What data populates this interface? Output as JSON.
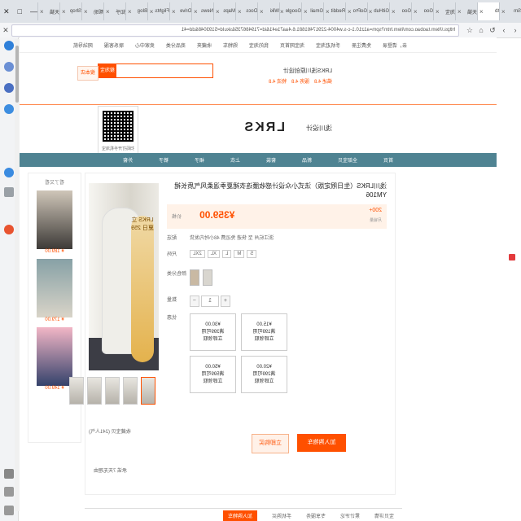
{
  "tabs": [
    "Sm",
    "tb",
    "天猫",
    "淘宝",
    "Goo",
    "Goo",
    "GitHub",
    "GoPro",
    "Reddit",
    "Gmail",
    "Google",
    "Wiki",
    "Docs",
    "Maps",
    "News",
    "Drive",
    "Flights",
    "Blog",
    "知乎",
    "帮助",
    "Shop",
    "天猫"
  ],
  "tab_colors": [
    "#ff5000",
    "#ff5000",
    "#e4393c",
    "#ff5000",
    "#4285f4",
    "#34a853",
    "#24292e",
    "#2a9fd8",
    "#ff4500",
    "#ea4335",
    "#4285f4",
    "#777777",
    "#4285f4",
    "#34a853",
    "#5f6368",
    "#0f9d58",
    "#4285f4",
    "#f57c00",
    "#0084ff",
    "#1976d2",
    "#ff5000",
    "#e4393c"
  ],
  "window_controls": {
    "min": "—",
    "max": "□",
    "close": "✕"
  },
  "address": {
    "url": "https://item.taobao.com/item.htm?spm=a1z10.1-c-s.w4004-22917461681.6.4aa71e41&id=719486735&skuId=5193048&dd=41"
  },
  "site_nav": [
    "亲，请登录",
    "免费注册",
    "手机逛淘宝",
    "淘宝网首页",
    "我的淘宝",
    "购物车",
    "收藏夹",
    "商品分类",
    "卖家中心",
    "联系客服",
    "网站导航"
  ],
  "shop": {
    "name": "LRKS浅川原创设计",
    "ratings": [
      "描述 4.8",
      "服务 4.8",
      "物流 4.8"
    ],
    "logo": "LRKS",
    "logo_sub": "浅川设计",
    "qr_caption": "扫码打开手机淘宝"
  },
  "search": {
    "placeholder": "",
    "button_all": "搜淘宝",
    "button_shop": "搜本店"
  },
  "menu": [
    "首页",
    "全部宝贝",
    "新品",
    "套装",
    "上衣",
    "裙子",
    "裤子",
    "外套"
  ],
  "recs": {
    "title": "看了又看",
    "prices": [
      "¥ 189.00",
      "¥ 179.00",
      "¥ 149.00"
    ]
  },
  "product": {
    "title": "浅川LRKS（生日限定版）法式小众设计感收腰连衣裙夏季温柔风气质长裙 YM106",
    "price_label": "价格",
    "price": "¥359.00",
    "sales": "200+",
    "sales_label": "月销量",
    "delivery_label": "配送",
    "delivery": "浙江杭州 至 快递 免运费 48小时内发货",
    "size_label": "尺码",
    "sizes": [
      "S",
      "M",
      "L",
      "XL",
      "2XL"
    ],
    "color_label": "颜色分类",
    "qty_label": "数量",
    "qty": "1",
    "coupon_label": "优惠",
    "coupons": [
      {
        "line1": "¥15.00",
        "line2": "满199可用",
        "line3": "立即领取"
      },
      {
        "line1": "¥30.00",
        "line2": "满399可用",
        "line3": "立即领取"
      },
      {
        "line1": "¥20.00",
        "line2": "满299可用",
        "line3": "立即领取"
      },
      {
        "line1": "¥50.00",
        "line2": "满599可用",
        "line3": "立即领取"
      }
    ],
    "buy_now": "立即购买",
    "add_cart": "加入购物车",
    "favorite": "收藏宝贝 (241人气)",
    "service": "承诺 7天无理由",
    "badge_text": "LRKS 立夏日 259"
  },
  "bottom": [
    "宝贝详情",
    "累计评论",
    "专享服务",
    "手机购买"
  ],
  "bottom_action": "加入购物车"
}
